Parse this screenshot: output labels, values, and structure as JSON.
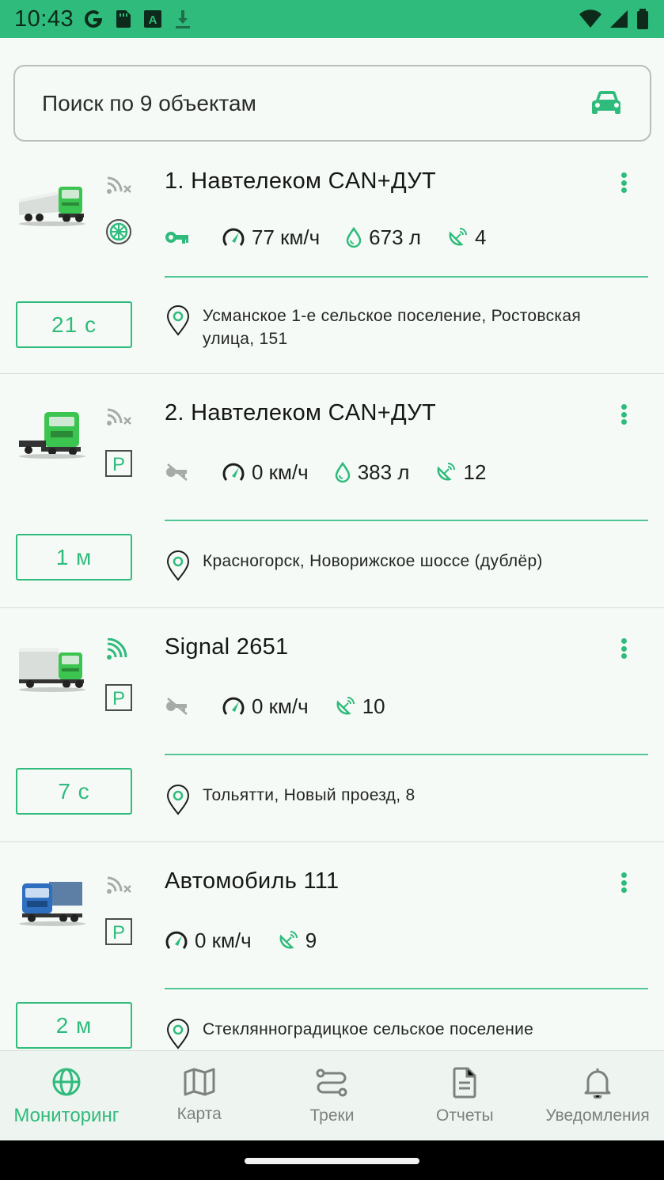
{
  "status_bar": {
    "time": "10:43",
    "icons": [
      "google-icon",
      "sim-icon",
      "a-icon",
      "download-icon",
      "wifi-icon",
      "cell-signal-icon",
      "battery-icon"
    ]
  },
  "search": {
    "placeholder": "Поиск по 9 объектам",
    "icon": "car-icon"
  },
  "colors": {
    "accent": "#2fbb7c",
    "background": "#f6faf6"
  },
  "objects": [
    {
      "title": "1. Навтелеком CAN+ДУТ",
      "truck_color": "green-tanker",
      "signal": "no-signal",
      "second_badge": "wheel",
      "metrics": [
        {
          "icon": "key-icon",
          "text": ""
        },
        {
          "icon": "speed-icon",
          "text": "77 км/ч"
        },
        {
          "icon": "fuel-icon",
          "text": "673 л"
        },
        {
          "icon": "satellite-icon",
          "text": "4"
        }
      ],
      "time": "21 с",
      "address": "Усманское 1-е сельское поселение, Ростовская улица, 151"
    },
    {
      "title": "2. Навтелеком CAN+ДУТ",
      "truck_color": "green-tractor",
      "signal": "no-signal",
      "second_badge": "parking",
      "metrics": [
        {
          "icon": "key-off-icon",
          "text": ""
        },
        {
          "icon": "speed-icon",
          "text": "0 км/ч"
        },
        {
          "icon": "fuel-icon",
          "text": "383 л"
        },
        {
          "icon": "satellite-icon",
          "text": "12"
        }
      ],
      "time": "1 м",
      "address": "Красногорск, Новорижское шоссе (дублёр)"
    },
    {
      "title": "Signal 2651",
      "truck_color": "green-box",
      "signal": "signal",
      "second_badge": "parking",
      "metrics": [
        {
          "icon": "key-off-icon",
          "text": ""
        },
        {
          "icon": "speed-icon",
          "text": "0 км/ч"
        },
        {
          "icon": "satellite-icon",
          "text": "10"
        }
      ],
      "time": "7 с",
      "address": "Тольятти, Новый проезд, 8"
    },
    {
      "title": "Автомобиль 111",
      "truck_color": "blue-truck",
      "signal": "no-signal",
      "second_badge": "parking",
      "metrics": [
        {
          "icon": "speed-icon",
          "text": "0 км/ч"
        },
        {
          "icon": "satellite-icon",
          "text": "9"
        }
      ],
      "time": "2 м",
      "address": "Стеклянноградицкое сельское поселение"
    }
  ],
  "bottom_nav": [
    {
      "label": "Мониторинг",
      "icon": "globe-icon",
      "active": true
    },
    {
      "label": "Карта",
      "icon": "map-icon",
      "active": false
    },
    {
      "label": "Треки",
      "icon": "route-icon",
      "active": false
    },
    {
      "label": "Отчеты",
      "icon": "report-icon",
      "active": false
    },
    {
      "label": "Уведомления",
      "icon": "bell-icon",
      "active": false
    }
  ]
}
